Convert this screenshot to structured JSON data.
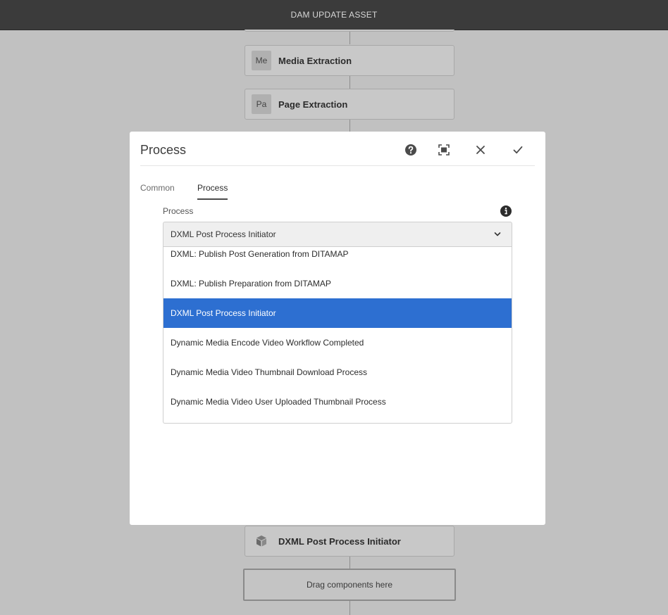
{
  "topbar": {
    "title": "DAM UPDATE ASSET"
  },
  "workflow": {
    "steps": [
      {
        "badge": "Me",
        "title": "Media Extraction"
      },
      {
        "badge": "Pa",
        "title": "Page Extraction"
      }
    ],
    "bottom_step": {
      "icon": "package-icon",
      "title": "DXML Post Process Initiator"
    },
    "drop_zone": "Drag components here"
  },
  "dialog": {
    "title": "Process",
    "tabs": [
      {
        "label": "Common",
        "active": false
      },
      {
        "label": "Process",
        "active": true
      }
    ],
    "field": {
      "label": "Process",
      "selected_value": "DXML Post Process Initiator",
      "options": [
        {
          "label": "DXML: Publish Post Generation from DITAMAP",
          "selected": false
        },
        {
          "label": "DXML: Publish Preparation from DITAMAP",
          "selected": false
        },
        {
          "label": "DXML Post Process Initiator",
          "selected": true
        },
        {
          "label": "Dynamic Media Encode Video Workflow Completed",
          "selected": false
        },
        {
          "label": "Dynamic Media Video Thumbnail Download Process",
          "selected": false
        },
        {
          "label": "Dynamic Media Video User Uploaded Thumbnail Process",
          "selected": false
        }
      ]
    }
  },
  "colors": {
    "accent": "#2d6fd1",
    "topbar": "#3b3b3b",
    "backdrop": "#c1c1c1"
  }
}
